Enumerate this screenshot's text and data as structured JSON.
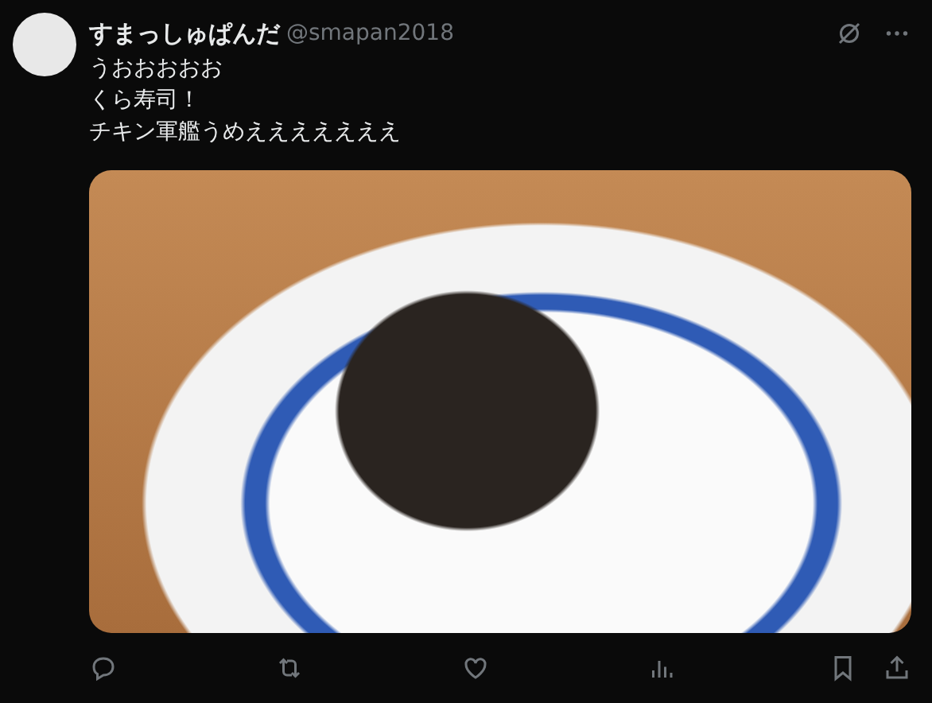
{
  "post": {
    "author_name": "すまっしゅぱんだ",
    "handle": "@smapan2018",
    "text_lines": [
      "うおおおおお",
      "くら寿司！",
      "チキン軍艦うめえええええええ"
    ]
  }
}
